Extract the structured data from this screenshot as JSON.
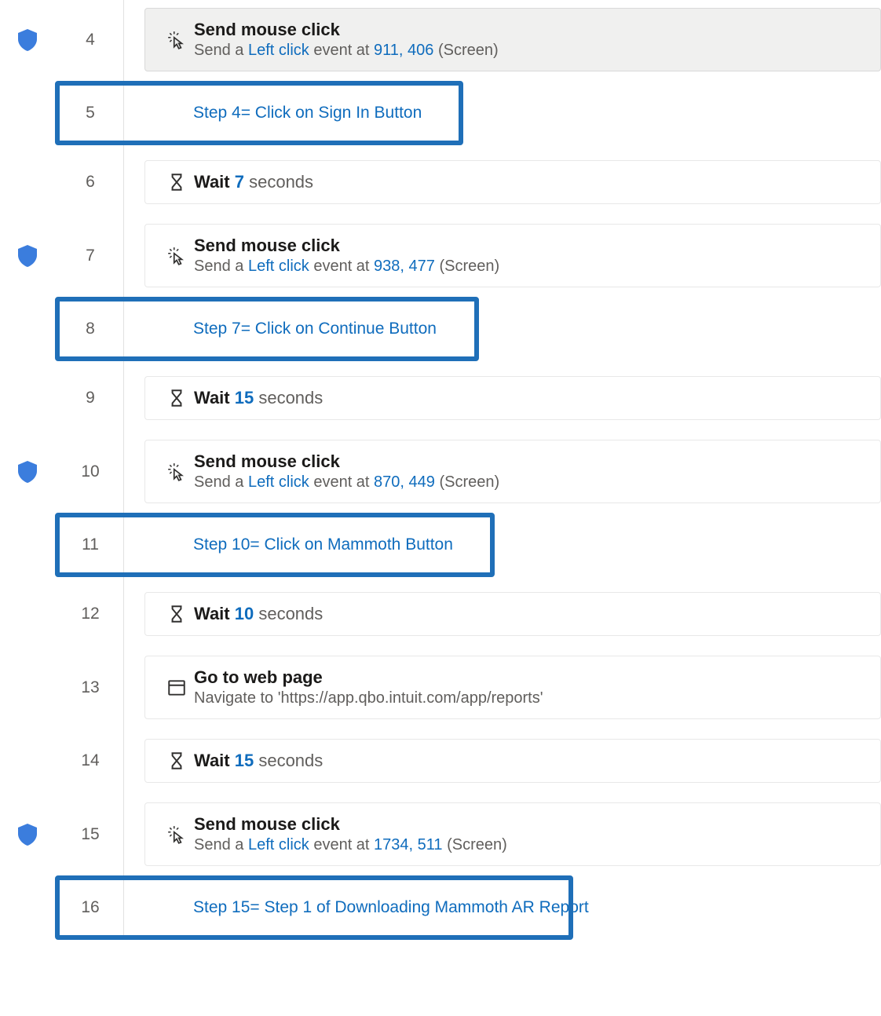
{
  "steps": [
    {
      "num": "4",
      "shield": true,
      "type": "click",
      "title": "Send mouse click",
      "sub_prefix": "Send a ",
      "click_type": "Left click",
      "sub_mid": " event at ",
      "coords": "911, 406",
      "sub_suffix": " (Screen)",
      "selected": true
    },
    {
      "num": "5",
      "shield": false,
      "type": "comment",
      "text": "Step 4= Click on Sign In Button",
      "boxed": true
    },
    {
      "num": "6",
      "shield": false,
      "type": "wait",
      "title": "Wait ",
      "value": "7",
      "unit": " seconds"
    },
    {
      "num": "7",
      "shield": true,
      "type": "click",
      "title": "Send mouse click",
      "sub_prefix": "Send a ",
      "click_type": "Left click",
      "sub_mid": " event at ",
      "coords": "938, 477",
      "sub_suffix": " (Screen)"
    },
    {
      "num": "8",
      "shield": false,
      "type": "comment",
      "text": "Step 7= Click on Continue Button",
      "boxed": true
    },
    {
      "num": "9",
      "shield": false,
      "type": "wait",
      "title": "Wait ",
      "value": "15",
      "unit": " seconds"
    },
    {
      "num": "10",
      "shield": true,
      "type": "click",
      "title": "Send mouse click",
      "sub_prefix": "Send a ",
      "click_type": "Left click",
      "sub_mid": " event at ",
      "coords": "870, 449",
      "sub_suffix": " (Screen)"
    },
    {
      "num": "11",
      "shield": false,
      "type": "comment",
      "text": "Step 10= Click on Mammoth Button",
      "boxed": true
    },
    {
      "num": "12",
      "shield": false,
      "type": "wait",
      "title": "Wait ",
      "value": "10",
      "unit": " seconds"
    },
    {
      "num": "13",
      "shield": false,
      "type": "goto",
      "title": "Go to web page",
      "sub_prefix": "Navigate to '",
      "url": "https://app.qbo.intuit.com/app/reports",
      "sub_suffix": "'"
    },
    {
      "num": "14",
      "shield": false,
      "type": "wait",
      "title": "Wait ",
      "value": "15",
      "unit": " seconds"
    },
    {
      "num": "15",
      "shield": true,
      "type": "click",
      "title": "Send mouse click",
      "sub_prefix": "Send a ",
      "click_type": "Left click",
      "sub_mid": " event at ",
      "coords": "1734, 511",
      "sub_suffix": " (Screen)"
    },
    {
      "num": "16",
      "shield": false,
      "type": "comment",
      "text": "Step 15= Step 1 of Downloading Mammoth AR Report",
      "boxed": true
    }
  ]
}
